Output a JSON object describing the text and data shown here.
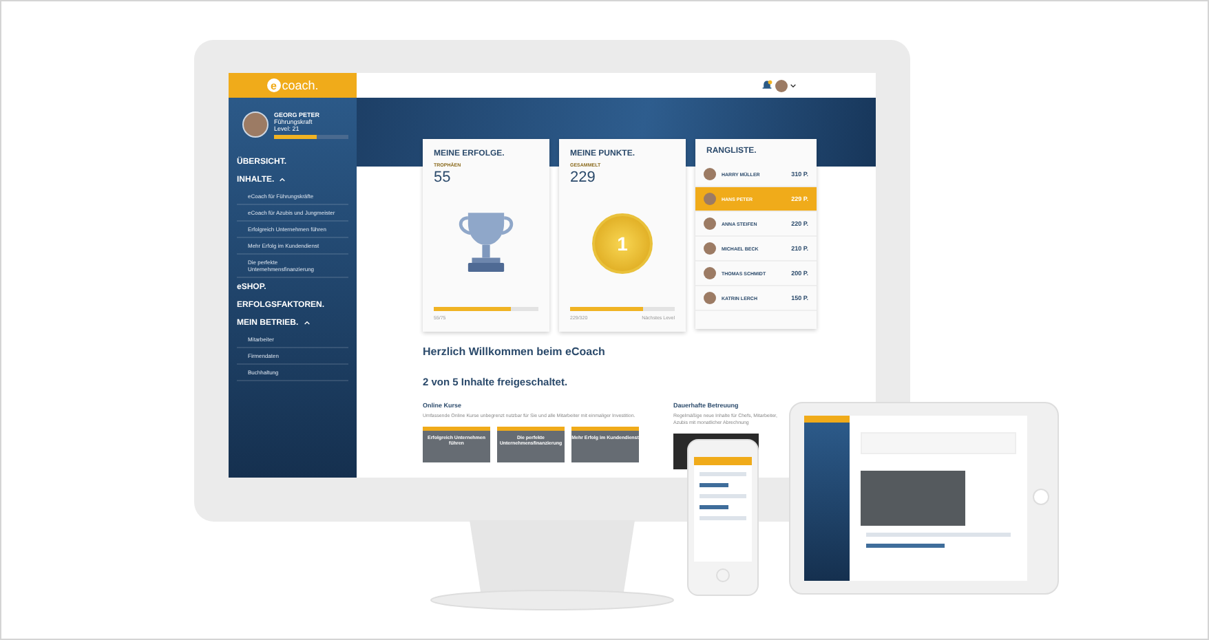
{
  "app": {
    "logo_initial": "e",
    "logo_word": "coach.",
    "profile": {
      "name": "GEORG PETER",
      "role": "Führungskraft",
      "level_label": "Level: 21",
      "level": 0.58
    },
    "nav": [
      {
        "label": "ÜBERSICHT.",
        "expanded": false
      },
      {
        "label": "INHALTE.",
        "expanded": true,
        "children": [
          "eCoach für Führungskräfte",
          "eCoach für Azubis und Jungmeister",
          "Erfolgreich Unternehmen führen",
          "Mehr Erfolg im Kundendienst",
          "Die perfekte Unternehmensfinanzierung"
        ]
      },
      {
        "label": "eSHOP.",
        "expanded": false
      },
      {
        "label": "ERFOLGSFAKTOREN.",
        "expanded": false
      },
      {
        "label": "MEIN BETRIEB.",
        "expanded": true,
        "children": [
          "Mitarbeiter",
          "Firmendaten",
          "Buchhaltung"
        ]
      }
    ],
    "cards": [
      {
        "kind": "trophy",
        "title": "MEINE ERFOLGE.",
        "label": "TROPHÄEN",
        "value": "55",
        "level": 0.74,
        "progress_text": "55/75"
      },
      {
        "kind": "medal",
        "title": "MEINE PUNKTE.",
        "label": "GESAMMELT",
        "value": "229",
        "badge_text": "1",
        "level": 0.7,
        "progress_text": "229/320",
        "note": "Nächstes Level"
      }
    ],
    "ranking": {
      "title": "RANGLISTE.",
      "rows": [
        {
          "name": "HARRY MÜLLER",
          "points": "310 P.",
          "selected": false
        },
        {
          "name": "HANS PETER",
          "points": "229 P.",
          "selected": true
        },
        {
          "name": "ANNA STEIFEN",
          "points": "220 P.",
          "selected": false
        },
        {
          "name": "MICHAEL BECK",
          "points": "210 P.",
          "selected": false
        },
        {
          "name": "THOMAS SCHMIDT",
          "points": "200 P.",
          "selected": false
        },
        {
          "name": "KATRIN LERCH",
          "points": "150 P.",
          "selected": false
        }
      ]
    },
    "welcome": "Herzlich Willkommen beim eCoach",
    "unlocked": "2 von 5 Inhalte freigeschaltet.",
    "offers": [
      {
        "title": "Online Kurse",
        "text": "Umfassende Online Kurse unbegrenzt nutzbar für Sie und alle Mitarbeiter mit einmaliger Investition.",
        "thumbs": [
          "Erfolgreich Unternehmen führen",
          "Die perfekte Unternehmensfinanzierung",
          "Mehr Erfolg im Kundendienst"
        ]
      },
      {
        "title": "Dauerhafte Betreuung",
        "text": "Regelmäßige neue Inhalte für Chefs, Mitarbeiter, Azubis mit monatlicher Abrechnung"
      }
    ]
  }
}
